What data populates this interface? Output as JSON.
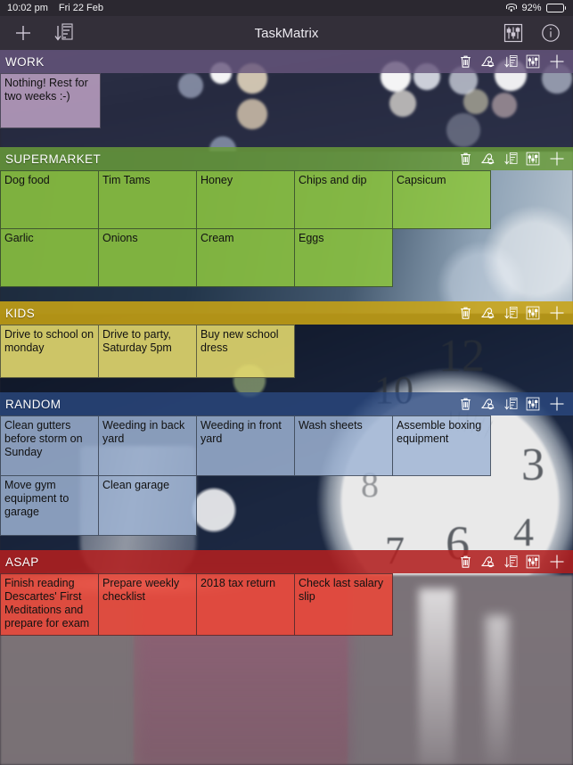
{
  "status_bar": {
    "time": "10:02 pm",
    "date": "Fri 22 Feb",
    "wifi_icon": "wifi-icon",
    "battery_percent": "92%",
    "battery_icon": "battery-icon"
  },
  "toolbar": {
    "title": "TaskMatrix",
    "add_icon": "plus-icon",
    "sort_icon": "sort-descending-icon",
    "settings_icon": "sliders-icon",
    "info_icon": "info-circle-icon"
  },
  "section_actions": {
    "delete_icon": "trash-icon",
    "archive_icon": "archive-icon",
    "sort_icon": "sort-descending-icon",
    "settings_icon": "sliders-icon",
    "add_icon": "plus-icon"
  },
  "colors": {
    "work_header": "#67557d",
    "work_card": "#c8aacd",
    "supermarket_header": "#689a3a",
    "supermarket_card": "#8dc63f",
    "kids_header": "#c7a314",
    "kids_card": "#e2d86e",
    "random_header": "#2b4880",
    "random_card": "#9eb4d4",
    "asap_header": "#b01f1f",
    "asap_card": "#e8483a",
    "toolbar_bg": "#332f39",
    "status_bg": "#2b2830"
  },
  "sections": [
    {
      "title": "WORK",
      "cards": [
        "Nothing! Rest for two weeks :-)"
      ]
    },
    {
      "title": "SUPERMARKET",
      "cards": [
        "Dog food",
        "Tim Tams",
        "Honey",
        "Chips and dip",
        "Capsicum",
        "Garlic",
        "Onions",
        "Cream",
        "Eggs"
      ]
    },
    {
      "title": "KIDS",
      "cards": [
        "Drive to school on monday",
        "Drive to party, Saturday 5pm",
        "Buy new school dress"
      ]
    },
    {
      "title": "RANDOM",
      "cards": [
        "Clean gutters before storm on Sunday",
        "Weeding in back yard",
        "Weeding in front yard",
        "Wash sheets",
        "Assemble boxing equipment",
        "Move gym equipment to garage",
        "Clean garage"
      ]
    },
    {
      "title": "ASAP",
      "cards": [
        "Finish reading Descartes' First Meditations and prepare for exam",
        "Prepare weekly checklist",
        "2018 tax return",
        "Check last salary slip"
      ]
    }
  ]
}
